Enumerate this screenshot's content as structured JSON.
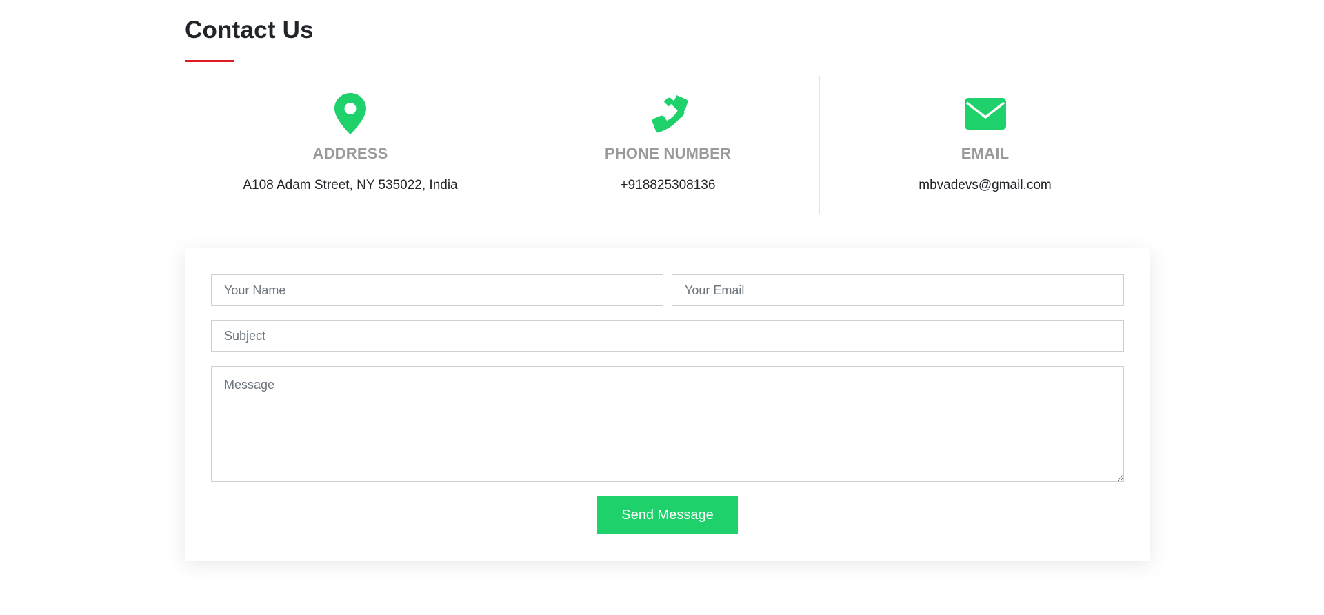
{
  "section": {
    "title": "Contact Us"
  },
  "colors": {
    "accent_underline": "#e01a22",
    "icon_green": "#1ed16b",
    "heading_gray": "#9a9a9a",
    "button_green": "#1ed16b"
  },
  "info": [
    {
      "icon": "map-pin-icon",
      "heading": "ADDRESS",
      "value": "A108 Adam Street, NY 535022, India"
    },
    {
      "icon": "phone-icon",
      "heading": "PHONE NUMBER",
      "value": "+918825308136"
    },
    {
      "icon": "envelope-icon",
      "heading": "EMAIL",
      "value": "mbvadevs@gmail.com"
    }
  ],
  "form": {
    "name_placeholder": "Your Name",
    "email_placeholder": "Your Email",
    "subject_placeholder": "Subject",
    "message_placeholder": "Message",
    "submit_label": "Send Message"
  }
}
